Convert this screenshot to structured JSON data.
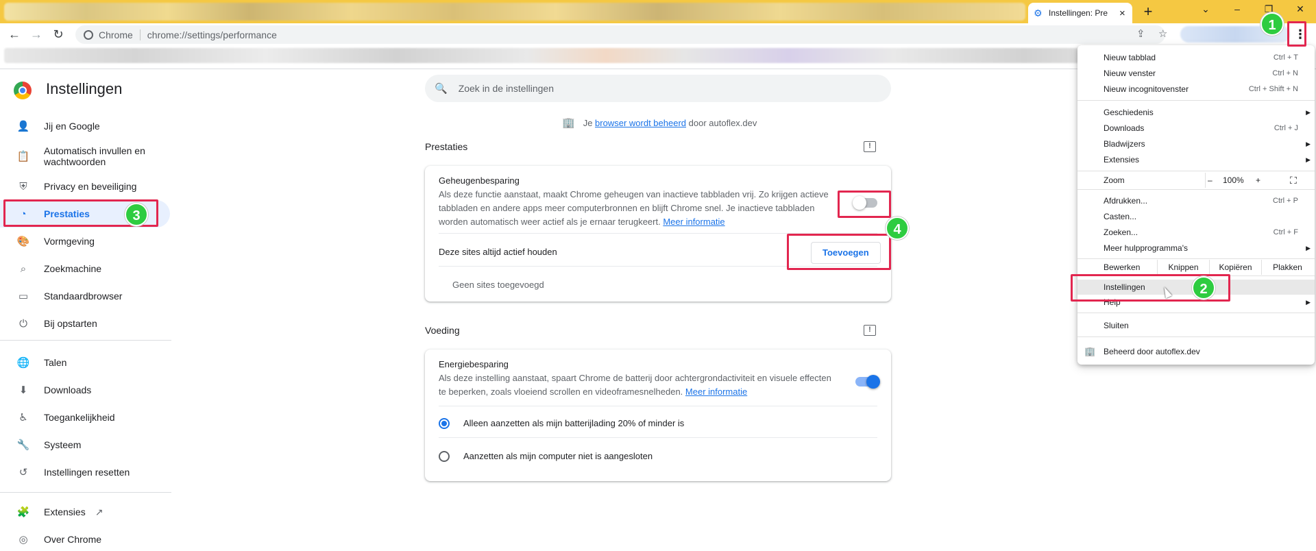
{
  "tab": {
    "title": "Instellingen: Pre",
    "close": "×"
  },
  "window": {
    "new_tab": "+",
    "minimize": "–",
    "maximize": "❐",
    "close": "✕",
    "tab_search": "⌄"
  },
  "omnibox": {
    "chip": "Chrome",
    "url": "chrome://settings/performance"
  },
  "settings": {
    "title": "Instellingen"
  },
  "sidebar": {
    "items": [
      {
        "label": "Jij en Google",
        "icon": "person-icon"
      },
      {
        "label": "Automatisch invullen en wachtwoorden",
        "icon": "clipboard-icon"
      },
      {
        "label": "Privacy en beveiliging",
        "icon": "shield-icon"
      },
      {
        "label": "Prestaties",
        "icon": "speedometer-icon"
      },
      {
        "label": "Vormgeving",
        "icon": "palette-icon"
      },
      {
        "label": "Zoekmachine",
        "icon": "search-icon"
      },
      {
        "label": "Standaardbrowser",
        "icon": "browser-icon"
      },
      {
        "label": "Bij opstarten",
        "icon": "power-icon"
      },
      {
        "label": "Talen",
        "icon": "globe-icon"
      },
      {
        "label": "Downloads",
        "icon": "download-icon"
      },
      {
        "label": "Toegankelijkheid",
        "icon": "accessibility-icon"
      },
      {
        "label": "Systeem",
        "icon": "wrench-icon"
      },
      {
        "label": "Instellingen resetten",
        "icon": "history-icon"
      },
      {
        "label": "Extensies",
        "icon": "puzzle-icon"
      },
      {
        "label": "Over Chrome",
        "icon": "chrome-icon"
      }
    ]
  },
  "search": {
    "placeholder": "Zoek in de instellingen"
  },
  "managed": {
    "prefix": "Je",
    "link": "browser wordt beheerd",
    "suffix": "door autoflex.dev"
  },
  "performance": {
    "section_title": "Prestaties",
    "memory_saver": {
      "title": "Geheugenbesparing",
      "description": "Als deze functie aanstaat, maakt Chrome geheugen van inactieve tabbladen vrij. Zo krijgen actieve tabbladen en andere apps meer computerbronnen en blijft Chrome snel. Je inactieve tabbladen worden automatisch weer actief als je ernaar terugkeert.",
      "link": "Meer informatie",
      "enabled": false
    },
    "always_active": {
      "label": "Deze sites altijd actief houden",
      "button": "Toevoegen",
      "empty": "Geen sites toegevoegd"
    }
  },
  "power": {
    "section_title": "Voeding",
    "energy_saver": {
      "title": "Energiebesparing",
      "description": "Als deze instelling aanstaat, spaart Chrome de batterij door achtergrondactiviteit en visuele effecten te beperken, zoals vloeiend scrollen en videoframesnelheden.",
      "link": "Meer informatie",
      "enabled": true
    },
    "options": [
      {
        "label": "Alleen aanzetten als mijn batterijlading 20% of minder is",
        "checked": true
      },
      {
        "label": "Aanzetten als mijn computer niet is aangesloten",
        "checked": false
      }
    ]
  },
  "menu": {
    "new_tab": {
      "label": "Nieuw tabblad",
      "shortcut": "Ctrl + T"
    },
    "new_window": {
      "label": "Nieuw venster",
      "shortcut": "Ctrl + N"
    },
    "incognito": {
      "label": "Nieuw incognitovenster",
      "shortcut": "Ctrl + Shift + N"
    },
    "history": {
      "label": "Geschiedenis"
    },
    "downloads": {
      "label": "Downloads",
      "shortcut": "Ctrl + J"
    },
    "bookmarks": {
      "label": "Bladwijzers"
    },
    "extensions": {
      "label": "Extensies"
    },
    "zoom": {
      "label": "Zoom",
      "minus": "–",
      "value": "100%",
      "plus": "+"
    },
    "print": {
      "label": "Afdrukken...",
      "shortcut": "Ctrl + P"
    },
    "cast": {
      "label": "Casten..."
    },
    "find": {
      "label": "Zoeken...",
      "shortcut": "Ctrl + F"
    },
    "more_tools": {
      "label": "Meer hulpprogramma's"
    },
    "edit": {
      "label": "Bewerken",
      "cut": "Knippen",
      "copy": "Kopiëren",
      "paste": "Plakken"
    },
    "settings": {
      "label": "Instellingen"
    },
    "help": {
      "label": "Help"
    },
    "exit": {
      "label": "Sluiten"
    },
    "managed": {
      "label": "Beheerd door autoflex.dev"
    }
  },
  "annotations": {
    "b1": "1",
    "b2": "2",
    "b3": "3",
    "b4": "4"
  },
  "colors": {
    "accent": "#1a73e8",
    "highlight": "#e2264f",
    "badge": "#2ecc40",
    "titlebar": "#f5c842"
  }
}
